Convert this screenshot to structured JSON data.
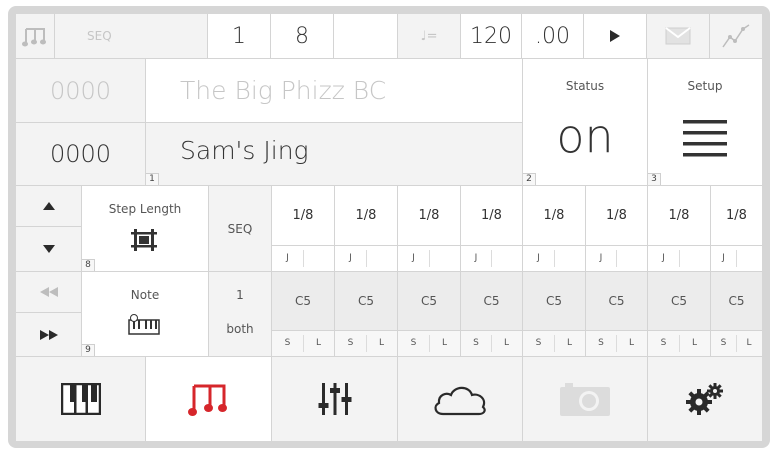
{
  "topbar": {
    "mode": "SEQ",
    "value1": "1",
    "value2": "8",
    "tempo_symbol": "♩=",
    "tempo": "120",
    "tempo_fraction": ".00"
  },
  "song": {
    "counter_a": "0000",
    "title": "The Big Phizz BC",
    "counter_b": "0000",
    "pattern_name": "Sam's Jing",
    "index": "1"
  },
  "status": {
    "label": "Status",
    "value": "on",
    "index": "2"
  },
  "setup": {
    "label": "Setup",
    "index": "3"
  },
  "step_length": {
    "label": "Step Length",
    "index": "8",
    "mode": "SEQ"
  },
  "note_section": {
    "label": "Note",
    "index": "9",
    "value": "1",
    "mode": "both"
  },
  "steps": [
    {
      "length": "1/8",
      "note": "C5"
    },
    {
      "length": "1/8",
      "note": "C5"
    },
    {
      "length": "1/8",
      "note": "C5"
    },
    {
      "length": "1/8",
      "note": "C5"
    },
    {
      "length": "1/8",
      "note": "C5"
    },
    {
      "length": "1/8",
      "note": "C5"
    },
    {
      "length": "1/8",
      "note": "C5"
    },
    {
      "length": "1/8",
      "note": "C5"
    }
  ],
  "step_sub_label": "J",
  "step_s_label": "S",
  "step_l_label": "L",
  "bottom_nav": [
    {
      "icon": "piano-icon",
      "active": false
    },
    {
      "icon": "music-note-icon",
      "active": true
    },
    {
      "icon": "mixer-sliders-icon",
      "active": false
    },
    {
      "icon": "cloud-icon",
      "active": false
    },
    {
      "icon": "camera-icon",
      "active": false
    },
    {
      "icon": "gears-icon",
      "active": false
    }
  ],
  "colors": {
    "accent": "#d6262b",
    "text": "#333333",
    "muted": "#c6c6c6"
  }
}
